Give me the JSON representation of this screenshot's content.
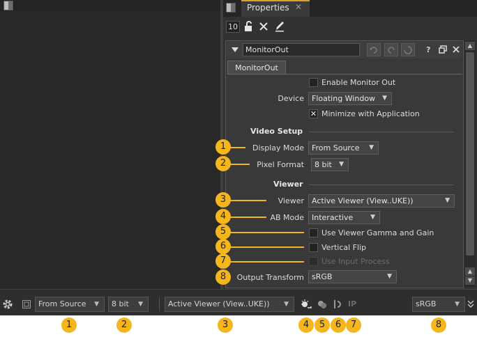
{
  "properties_panel": {
    "tab_label": "Properties",
    "tab_close": "✕",
    "toolbar": {
      "max_panels": "10"
    },
    "node_name": "MonitorOut",
    "help_button": "?",
    "node_tab": "MonitorOut",
    "enable_monitor_out": {
      "label": "Enable Monitor Out",
      "checked": false
    },
    "device": {
      "label": "Device",
      "value": "Floating Window"
    },
    "minimize_with_application": {
      "label": "Minimize with Application",
      "checked": true
    },
    "video_setup": {
      "title": "Video Setup",
      "display_mode": {
        "label": "Display Mode",
        "value": "From Source"
      },
      "pixel_format": {
        "label": "Pixel Format",
        "value": "8 bit"
      }
    },
    "viewer_section": {
      "title": "Viewer",
      "viewer": {
        "label": "Viewer",
        "value": "Active Viewer (View..UKE))"
      },
      "ab_mode": {
        "label": "AB Mode",
        "value": "Interactive"
      },
      "use_viewer_gamma_gain": {
        "label": "Use Viewer Gamma and Gain",
        "checked": false
      },
      "vertical_flip": {
        "label": "Vertical Flip",
        "checked": false
      },
      "use_input_process": {
        "label": "Use Input Process",
        "checked": false,
        "disabled": true
      },
      "output_transform": {
        "label": "Output Transform",
        "value": "sRGB"
      }
    }
  },
  "bottom_toolbar": {
    "display_mode": "From Source",
    "pixel_format": "8 bit",
    "viewer": "Active Viewer (View..UKE))",
    "input_process_label": "IP",
    "output_transform": "sRGB"
  },
  "callouts": {
    "panel": [
      "1",
      "2",
      "3",
      "4",
      "5",
      "6",
      "7",
      "8"
    ],
    "toolbar": [
      "1",
      "2",
      "3",
      "4",
      "5",
      "6",
      "7",
      "8"
    ]
  },
  "colors": {
    "callout": "#f5b51c",
    "tab_accent": "#e0a030",
    "panel_bg": "#393939"
  }
}
